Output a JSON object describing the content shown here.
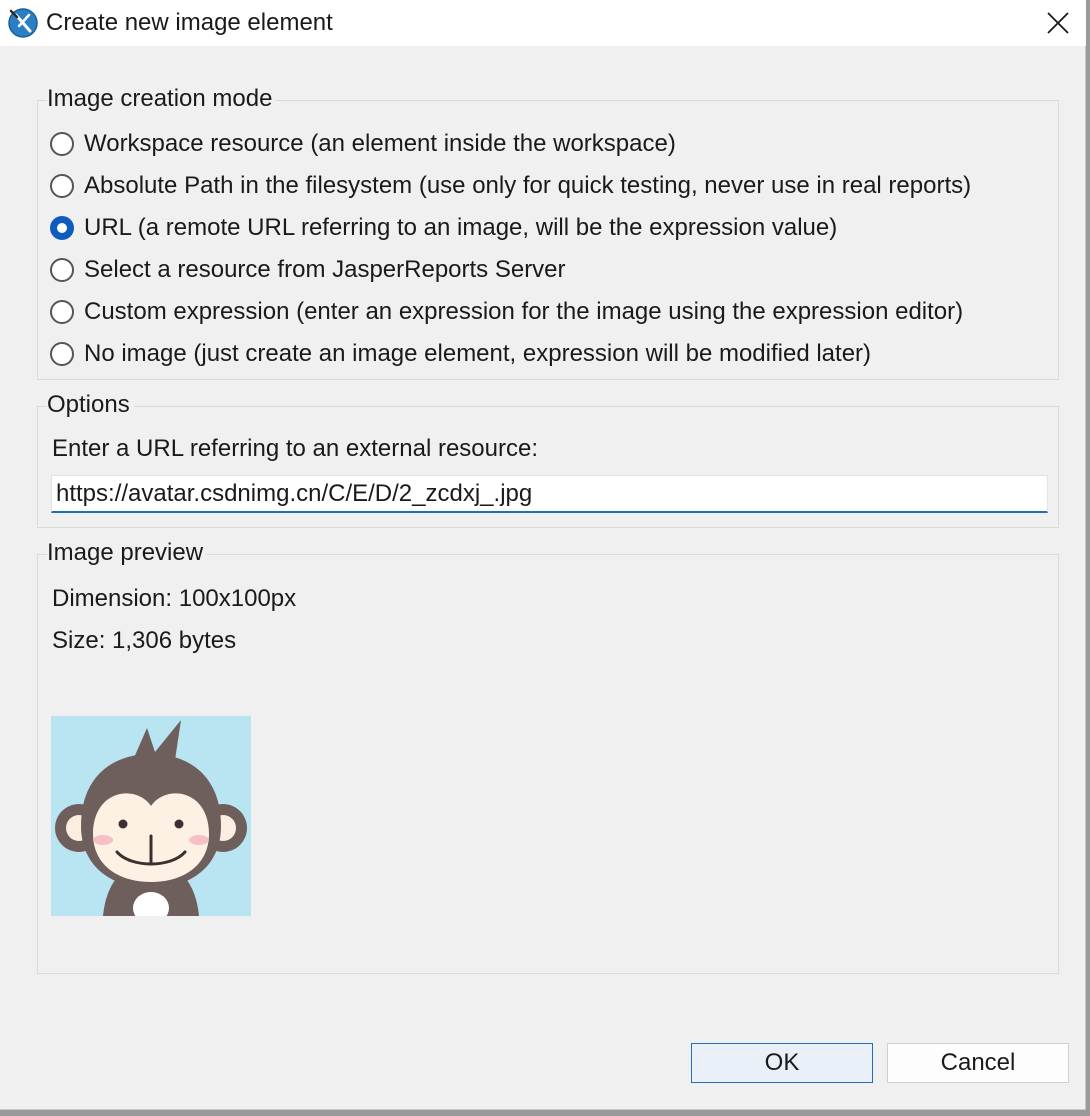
{
  "window": {
    "title": "Create new image element"
  },
  "creation_mode": {
    "title": "Image creation mode",
    "options": [
      {
        "label": "Workspace resource (an element inside the workspace)",
        "selected": false
      },
      {
        "label": "Absolute Path in the filesystem (use only for quick testing, never use in real reports)",
        "selected": false
      },
      {
        "label": "URL (a remote URL referring to an image, will be the expression value)",
        "selected": true
      },
      {
        "label": "Select a resource from JasperReports Server",
        "selected": false
      },
      {
        "label": "Custom expression (enter an expression for the image using the expression editor)",
        "selected": false
      },
      {
        "label": "No image (just create an image element, expression will be modified later)",
        "selected": false
      }
    ]
  },
  "options": {
    "title": "Options",
    "url_label": "Enter a URL referring to an external resource:",
    "url_value": "https://avatar.csdnimg.cn/C/E/D/2_zcdxj_.jpg"
  },
  "preview": {
    "title": "Image preview",
    "dimension": "Dimension: 100x100px",
    "size": "Size: 1,306 bytes"
  },
  "buttons": {
    "ok": "OK",
    "cancel": "Cancel"
  },
  "colors": {
    "accent": "#0f5cbf",
    "dialog_bg": "#f0f0f0",
    "preview_bg": "#b9e4f2"
  }
}
